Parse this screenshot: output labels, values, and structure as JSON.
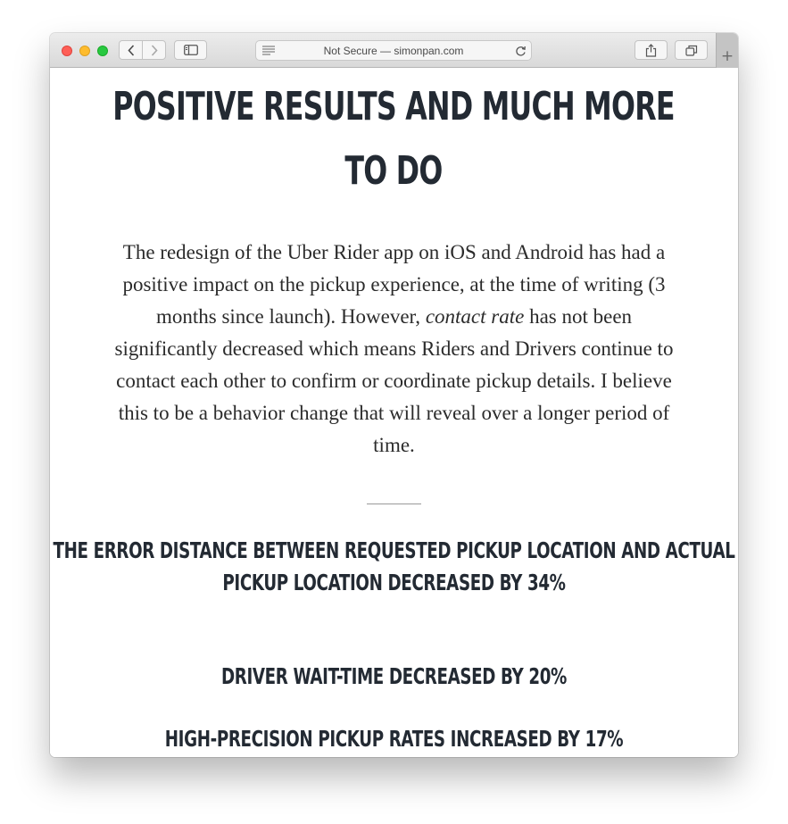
{
  "browser": {
    "address": "Not Secure — simonpan.com",
    "new_tab_label": "+"
  },
  "article": {
    "heading": "POSITIVE RESULTS AND MUCH MORE TO DO",
    "paragraph_before": "The redesign of the Uber Rider app on iOS and Android has had a positive impact on the pickup experience, at the time of writing (3 months since launch). However, ",
    "paragraph_emphasis": "contact rate",
    "paragraph_after": " has not been significantly decreased which means Riders and Drivers continue to contact each other to confirm or coordinate pickup details. I believe this to be a behavior change that will reveal over a longer period of time.",
    "stats": [
      "THE ERROR DISTANCE BETWEEN REQUESTED PICKUP LOCATION AND ACTUAL PICKUP LOCATION DECREASED BY 34%",
      "DRIVER WAIT-TIME DECREASED BY 20%",
      "HIGH-PRECISION PICKUP RATES INCREASED BY 17%"
    ]
  }
}
